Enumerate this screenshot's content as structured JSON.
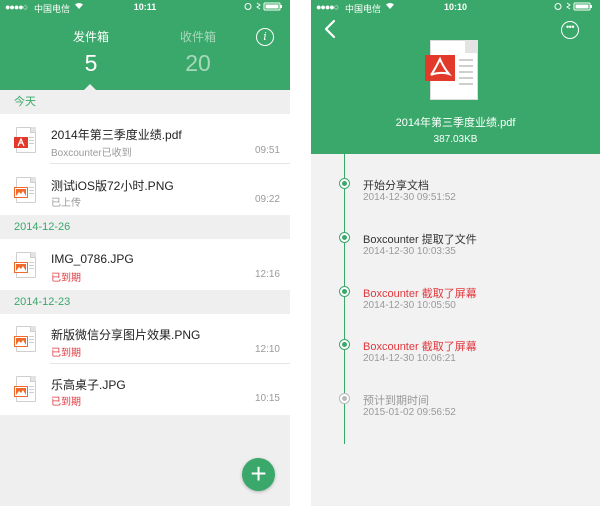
{
  "status_left": {
    "carrier": "中国电信",
    "time": "10:11"
  },
  "status_right": {
    "carrier": "中国电信",
    "time": "10:10"
  },
  "header": {
    "outbox_label": "发件箱",
    "outbox_count": "5",
    "inbox_label": "收件箱",
    "inbox_count": "20",
    "info_label": "i"
  },
  "sections": [
    {
      "label": "今天",
      "files": [
        {
          "name": "2014年第三季度业绩.pdf",
          "status": "Boxcounter已收到",
          "time": "09:51",
          "icon": "pdf-file-icon"
        },
        {
          "name": "测试iOS版72小时.PNG",
          "status": "已上传",
          "time": "09:22",
          "icon": "image-file-icon"
        }
      ]
    },
    {
      "label": "2014-12-26",
      "files": [
        {
          "name": "IMG_0786.JPG",
          "status": "已到期",
          "time": "12:16",
          "icon": "image-file-icon"
        }
      ]
    },
    {
      "label": "2014-12-23",
      "files": [
        {
          "name": "新版微信分享图片效果.PNG",
          "status": "已到期",
          "time": "12:10",
          "icon": "image-file-icon"
        },
        {
          "name": "乐高桌子.JPG",
          "status": "已到期",
          "time": "10:15",
          "icon": "image-file-icon"
        }
      ]
    }
  ],
  "fab_label": "+",
  "detail": {
    "more_label": "•••",
    "filename": "2014年第三季度业绩.pdf",
    "size": "387.03KB",
    "events": [
      {
        "title": "开始分享文档",
        "time": "2014-12-30 09:51:52"
      },
      {
        "title": "Boxcounter 提取了文件",
        "time": "2014-12-30 10:03:35"
      },
      {
        "title": "Boxcounter 截取了屏幕",
        "time": "2014-12-30 10:05:50"
      },
      {
        "title": "Boxcounter 截取了屏幕",
        "time": "2014-12-30 10:06:21"
      },
      {
        "title": "预计到期时间",
        "time": "2015-01-02 09:56:52"
      }
    ]
  },
  "colors": {
    "brand_green": "#3aa86a",
    "alert_red": "#e0383e",
    "pdf_red": "#e23a2a",
    "image_orange": "#f06a2b"
  }
}
